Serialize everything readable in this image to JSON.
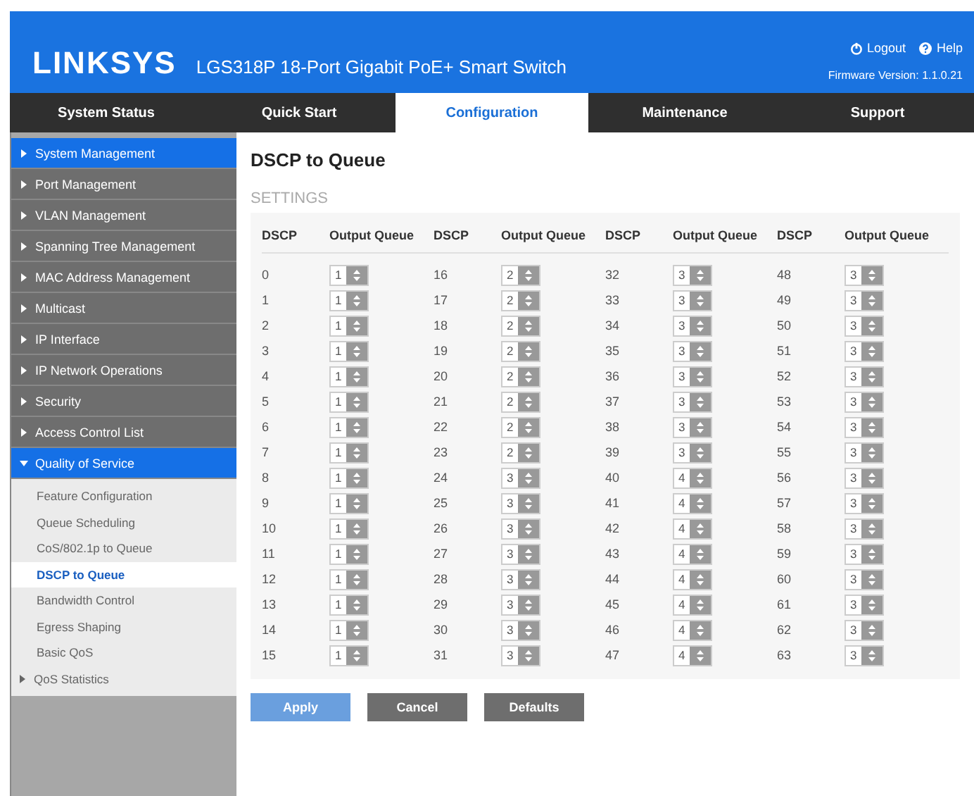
{
  "header": {
    "logo": "LINKSYS",
    "product": "LGS318P 18-Port Gigabit PoE+ Smart Switch",
    "links": [
      {
        "label": "Logout",
        "kind": "power"
      },
      {
        "label": "Help",
        "kind": "help"
      }
    ],
    "firmware": "Firmware Version: 1.1.0.21"
  },
  "nav_tabs": [
    {
      "label": "System Status",
      "selected": false
    },
    {
      "label": "Quick Start",
      "selected": false
    },
    {
      "label": "Configuration",
      "selected": true
    },
    {
      "label": "Maintenance",
      "selected": false
    },
    {
      "label": "Support",
      "selected": false
    }
  ],
  "sidebar": {
    "items": [
      {
        "label": "System Management",
        "selected": true,
        "expanded": false
      },
      {
        "label": "Port Management",
        "selected": false,
        "expanded": false
      },
      {
        "label": "VLAN Management",
        "selected": false,
        "expanded": false
      },
      {
        "label": "Spanning Tree Management",
        "selected": false,
        "expanded": false
      },
      {
        "label": "MAC Address Management",
        "selected": false,
        "expanded": false
      },
      {
        "label": "Multicast",
        "selected": false,
        "expanded": false
      },
      {
        "label": "IP Interface",
        "selected": false,
        "expanded": false
      },
      {
        "label": "IP Network Operations",
        "selected": false,
        "expanded": false
      },
      {
        "label": "Security",
        "selected": false,
        "expanded": false
      },
      {
        "label": "Access Control List",
        "selected": false,
        "expanded": false
      },
      {
        "label": "Quality of Service",
        "selected": true,
        "expanded": true,
        "children": [
          {
            "label": "Feature Configuration",
            "selected": false,
            "expandable": false
          },
          {
            "label": "Queue Scheduling",
            "selected": false,
            "expandable": false
          },
          {
            "label": "CoS/802.1p to Queue",
            "selected": false,
            "expandable": false
          },
          {
            "label": "DSCP to Queue",
            "selected": true,
            "expandable": false
          },
          {
            "label": "Bandwidth Control",
            "selected": false,
            "expandable": false
          },
          {
            "label": "Egress Shaping",
            "selected": false,
            "expandable": false
          },
          {
            "label": "Basic QoS",
            "selected": false,
            "expandable": false
          },
          {
            "label": "QoS Statistics",
            "selected": false,
            "expandable": true
          }
        ]
      }
    ]
  },
  "page": {
    "title": "DSCP to Queue",
    "section": "SETTINGS",
    "table": {
      "columns": [
        "DSCP",
        "Output Queue",
        "DSCP",
        "Output Queue",
        "DSCP",
        "Output Queue",
        "DSCP",
        "Output Queue"
      ],
      "rows": [
        [
          "0",
          "1",
          "16",
          "2",
          "32",
          "3",
          "48",
          "3"
        ],
        [
          "1",
          "1",
          "17",
          "2",
          "33",
          "3",
          "49",
          "3"
        ],
        [
          "2",
          "1",
          "18",
          "2",
          "34",
          "3",
          "50",
          "3"
        ],
        [
          "3",
          "1",
          "19",
          "2",
          "35",
          "3",
          "51",
          "3"
        ],
        [
          "4",
          "1",
          "20",
          "2",
          "36",
          "3",
          "52",
          "3"
        ],
        [
          "5",
          "1",
          "21",
          "2",
          "37",
          "3",
          "53",
          "3"
        ],
        [
          "6",
          "1",
          "22",
          "2",
          "38",
          "3",
          "54",
          "3"
        ],
        [
          "7",
          "1",
          "23",
          "2",
          "39",
          "3",
          "55",
          "3"
        ],
        [
          "8",
          "1",
          "24",
          "3",
          "40",
          "4",
          "56",
          "3"
        ],
        [
          "9",
          "1",
          "25",
          "3",
          "41",
          "4",
          "57",
          "3"
        ],
        [
          "10",
          "1",
          "26",
          "3",
          "42",
          "4",
          "58",
          "3"
        ],
        [
          "11",
          "1",
          "27",
          "3",
          "43",
          "4",
          "59",
          "3"
        ],
        [
          "12",
          "1",
          "28",
          "3",
          "44",
          "4",
          "60",
          "3"
        ],
        [
          "13",
          "1",
          "29",
          "3",
          "45",
          "4",
          "61",
          "3"
        ],
        [
          "14",
          "1",
          "30",
          "3",
          "46",
          "4",
          "62",
          "3"
        ],
        [
          "15",
          "1",
          "31",
          "3",
          "47",
          "4",
          "63",
          "3"
        ]
      ]
    },
    "buttons": [
      {
        "label": "Apply",
        "kind": "primary"
      },
      {
        "label": "Cancel",
        "kind": "secondary"
      },
      {
        "label": "Defaults",
        "kind": "secondary"
      }
    ]
  }
}
